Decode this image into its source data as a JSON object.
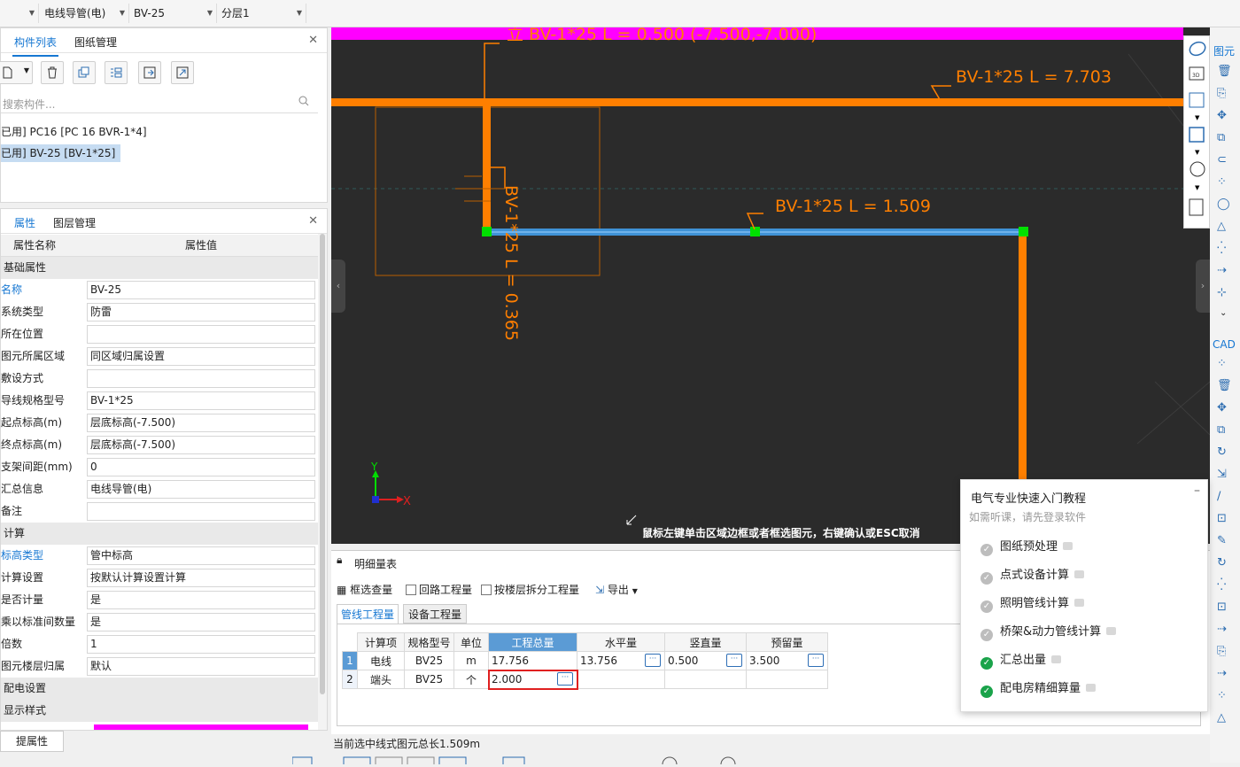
{
  "topbar": {
    "dropdown1": "",
    "dropdown2": "电线导管(电)",
    "dropdown3": "BV-25",
    "dropdown4": "分层1"
  },
  "component_panel": {
    "tabs": [
      "构件列表",
      "图纸管理"
    ],
    "search_placeholder": "搜索构件...",
    "items": [
      {
        "label": "已用] PC16 [PC 16 BVR-1*4]",
        "selected": false
      },
      {
        "label": "已用] BV-25 [BV-1*25]",
        "selected": true
      }
    ]
  },
  "property_panel": {
    "tabs": [
      "属性",
      "图层管理"
    ],
    "col_name": "属性名称",
    "col_value": "属性值",
    "rows": [
      {
        "group": "基础属性"
      },
      {
        "name": "名称",
        "value": "BV-25",
        "blue": true
      },
      {
        "name": "系统类型",
        "value": "防雷"
      },
      {
        "name": "所在位置",
        "value": ""
      },
      {
        "name": "图元所属区域",
        "value": "同区域归属设置"
      },
      {
        "name": "敷设方式",
        "value": ""
      },
      {
        "name": "导线规格型号",
        "value": "BV-1*25"
      },
      {
        "name": "起点标高(m)",
        "value": "层底标高(-7.500)"
      },
      {
        "name": "终点标高(m)",
        "value": "层底标高(-7.500)"
      },
      {
        "name": "支架间距(mm)",
        "value": "0"
      },
      {
        "name": "汇总信息",
        "value": "电线导管(电)"
      },
      {
        "name": "备注",
        "value": ""
      },
      {
        "group": "计算"
      },
      {
        "name": "标高类型",
        "value": "管中标高",
        "blue": true
      },
      {
        "name": "计算设置",
        "value": "按默认计算设置计算"
      },
      {
        "name": "是否计量",
        "value": "是"
      },
      {
        "name": "乘以标准间数量",
        "value": "是"
      },
      {
        "name": "倍数",
        "value": "1"
      },
      {
        "name": "图元楼层归属",
        "value": "默认"
      },
      {
        "group": "配电设置"
      },
      {
        "group": "显示样式"
      }
    ],
    "bottom_button": "提属性"
  },
  "cad": {
    "label_vertical_top": "立 BV-1*25 L = 0.500 (-7.500,-7.000)",
    "label_top_right": "BV-1*25 L = 7.703",
    "label_mid": "BV-1*25 L = 1.509",
    "label_rotated": "BV-1*25 L = 0.365",
    "axis_x": "X",
    "axis_y": "Y",
    "hint": "鼠标左键单击区域边框或者框选图元，右键确认或ESC取消",
    "colors": {
      "background": "#2b2b2b",
      "pipe": "#ff7f00",
      "selected": "#4fa3e0",
      "grip": "#00e000",
      "top_band": "#ff00ff"
    }
  },
  "quantity": {
    "title": "明细量表",
    "toolbar": {
      "box_select": "框选查量",
      "loop_qty": "回路工程量",
      "floor_split": "按楼层拆分工程量",
      "export": "导出"
    },
    "tabs": [
      "管线工程量",
      "设备工程量"
    ],
    "columns": [
      "计算项",
      "规格型号",
      "单位",
      "工程总量",
      "水平量",
      "竖直量",
      "预留量"
    ],
    "rows": [
      {
        "n": "1",
        "item": "电线",
        "spec": "BV25",
        "unit": "m",
        "total": "17.756",
        "horizontal": "13.756",
        "vertical": "0.500",
        "reserve": "3.500"
      },
      {
        "n": "2",
        "item": "端头",
        "spec": "BV25",
        "unit": "个",
        "total": "2.000",
        "horizontal": "",
        "vertical": "",
        "reserve": ""
      }
    ]
  },
  "status": {
    "message": "当前选中线式图元总长1.509m"
  },
  "tutorial": {
    "title": "电气专业快速入门教程",
    "subtitle": "如需听课，请先登录软件",
    "items": [
      {
        "label": "图纸预处理",
        "done": false
      },
      {
        "label": "点式设备计算",
        "done": false
      },
      {
        "label": "照明管线计算",
        "done": false
      },
      {
        "label": "桥架&动力管线计算",
        "done": false
      },
      {
        "label": "汇总出量",
        "done": true
      },
      {
        "label": "配电房精细算量",
        "done": true
      }
    ]
  },
  "right_toolbar": {
    "top_label": "图元",
    "cad_label": "CAD"
  }
}
